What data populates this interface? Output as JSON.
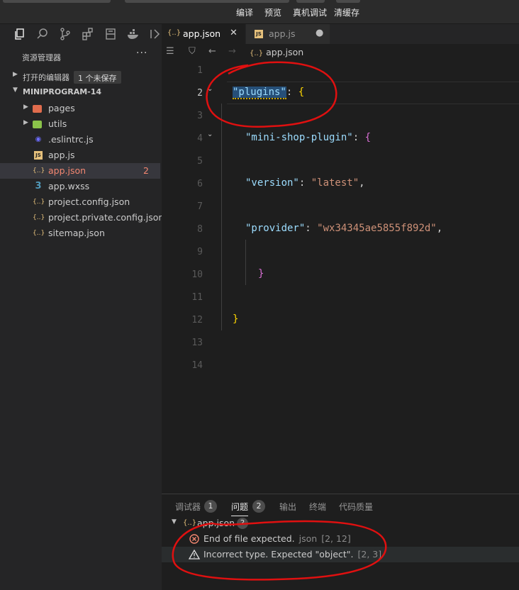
{
  "toolbar": {
    "compile": "编译",
    "preview": "预览",
    "remote_debug": "真机调试",
    "clear_cache": "清缓存"
  },
  "activity_icons": [
    "files-icon",
    "search-icon",
    "source-control-icon",
    "extensions-icon",
    "storage-icon",
    "docker-icon",
    "panel-toggle-icon"
  ],
  "explorer": {
    "title": "资源管理器",
    "more": "···",
    "open_editors": {
      "label": "打开的编辑器",
      "badge": "1 个未保存"
    },
    "project": {
      "label": "MINIPROGRAM-14",
      "items": [
        {
          "name": "pages",
          "icon": "folder-icon",
          "folder": true,
          "problems": ""
        },
        {
          "name": "utils",
          "icon": "folder-icon",
          "folder": true,
          "problems": ""
        },
        {
          "name": ".eslintrc.js",
          "icon": "eslint-icon",
          "folder": false,
          "problems": ""
        },
        {
          "name": "app.js",
          "icon": "js-file-icon",
          "folder": false,
          "problems": ""
        },
        {
          "name": "app.json",
          "icon": "json-file-icon",
          "folder": false,
          "problems": "2",
          "selected": true
        },
        {
          "name": "app.wxss",
          "icon": "css-file-icon",
          "folder": false,
          "problems": ""
        },
        {
          "name": "project.config.json",
          "icon": "json-file-icon",
          "folder": false,
          "problems": ""
        },
        {
          "name": "project.private.config.json",
          "icon": "json-file-icon",
          "folder": false,
          "problems": ""
        },
        {
          "name": "sitemap.json",
          "icon": "json-file-icon",
          "folder": false,
          "problems": ""
        }
      ]
    }
  },
  "tabs": [
    {
      "label": "app.json",
      "icon": "{..}",
      "active": true,
      "close": "✕"
    },
    {
      "label": "app.js",
      "icon": "JS",
      "active": false,
      "close": "●"
    }
  ],
  "breadcrumb": {
    "icon": "{..}",
    "file": "app.json"
  },
  "code": {
    "line_numbers": [
      "1",
      "2",
      "3",
      "4",
      "5",
      "6",
      "7",
      "8",
      "9",
      "10",
      "11",
      "12",
      "13",
      "14"
    ],
    "l2_key": "\"plugins\"",
    "l2_rest": ": ",
    "l2_brace": "{",
    "l4_key": "\"mini-shop-plugin\"",
    "l4_rest": ": ",
    "l4_brace": "{",
    "l6_key": "\"version\"",
    "l6_colon": ": ",
    "l6_val": "\"latest\"",
    "l6_comma": ",",
    "l8_key": "\"provider\"",
    "l8_colon": ": ",
    "l8_val": "\"wx34345ae5855f892d\"",
    "l8_comma": ",",
    "l10_brace": "}",
    "l12_brace": "}"
  },
  "panel": {
    "tabs": [
      {
        "label": "调试器",
        "badge": "1"
      },
      {
        "label": "问题",
        "badge": "2",
        "active": true
      },
      {
        "label": "输出"
      },
      {
        "label": "终端"
      },
      {
        "label": "代码质量"
      }
    ],
    "group": {
      "file": "app.json",
      "icon": "{..}",
      "count": "2"
    },
    "problems": [
      {
        "severity": "error",
        "icon": "error-circle-icon",
        "message": "End of file expected.",
        "source": "json",
        "location": "[2, 12]"
      },
      {
        "severity": "warning",
        "icon": "warning-triangle-icon",
        "message": "Incorrect type. Expected \"object\".",
        "source": "",
        "location": "[2, 3]"
      }
    ]
  },
  "colors": {
    "annotation": "#e01010",
    "error": "#f48771",
    "warning": "#cca700"
  }
}
